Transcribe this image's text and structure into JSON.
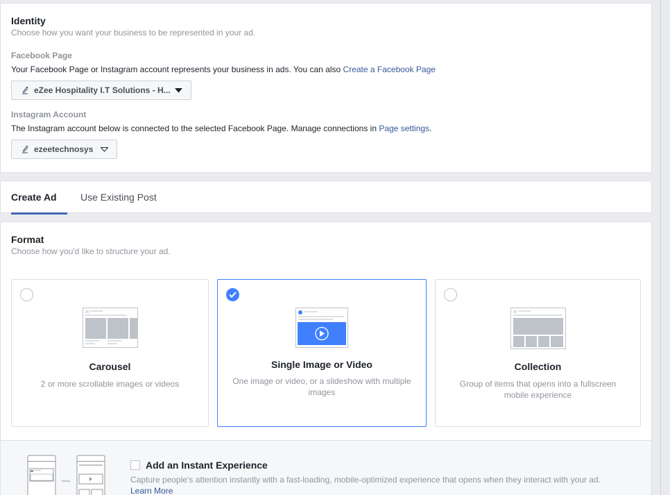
{
  "identity": {
    "title": "Identity",
    "subtitle": "Choose how you want your business to be represented in your ad.",
    "facebook_page": {
      "label": "Facebook Page",
      "description": "Your Facebook Page or Instagram account represents your business in ads. You can also ",
      "link": "Create a Facebook Page",
      "selected": "eZee Hospitality I.T Solutions - H..."
    },
    "instagram": {
      "label": "Instagram Account",
      "description": "The Instagram account below is connected to the selected Facebook Page. Manage connections in ",
      "link": "Page settings",
      "suffix": ".",
      "selected": "ezeetechnosys"
    }
  },
  "tabs": [
    {
      "label": "Create Ad",
      "active": true
    },
    {
      "label": "Use Existing Post",
      "active": false
    }
  ],
  "format": {
    "title": "Format",
    "subtitle": "Choose how you'd like to structure your ad.",
    "options": [
      {
        "title": "Carousel",
        "description": "2 or more scrollable images or videos",
        "selected": false
      },
      {
        "title": "Single Image or Video",
        "description": "One image or video, or a slideshow with multiple images",
        "selected": true
      },
      {
        "title": "Collection",
        "description": "Group of items that opens into a fullscreen mobile experience",
        "selected": false
      }
    ]
  },
  "instant_experience": {
    "title": "Add an Instant Experience",
    "description": "Capture people's attention instantly with a fast-loading, mobile-optimized experience that opens when they interact with your ad.",
    "link": "Learn More",
    "checked": false
  },
  "colors": {
    "accent": "#4080ff",
    "link": "#365899",
    "tab_underline": "#4267b2"
  }
}
